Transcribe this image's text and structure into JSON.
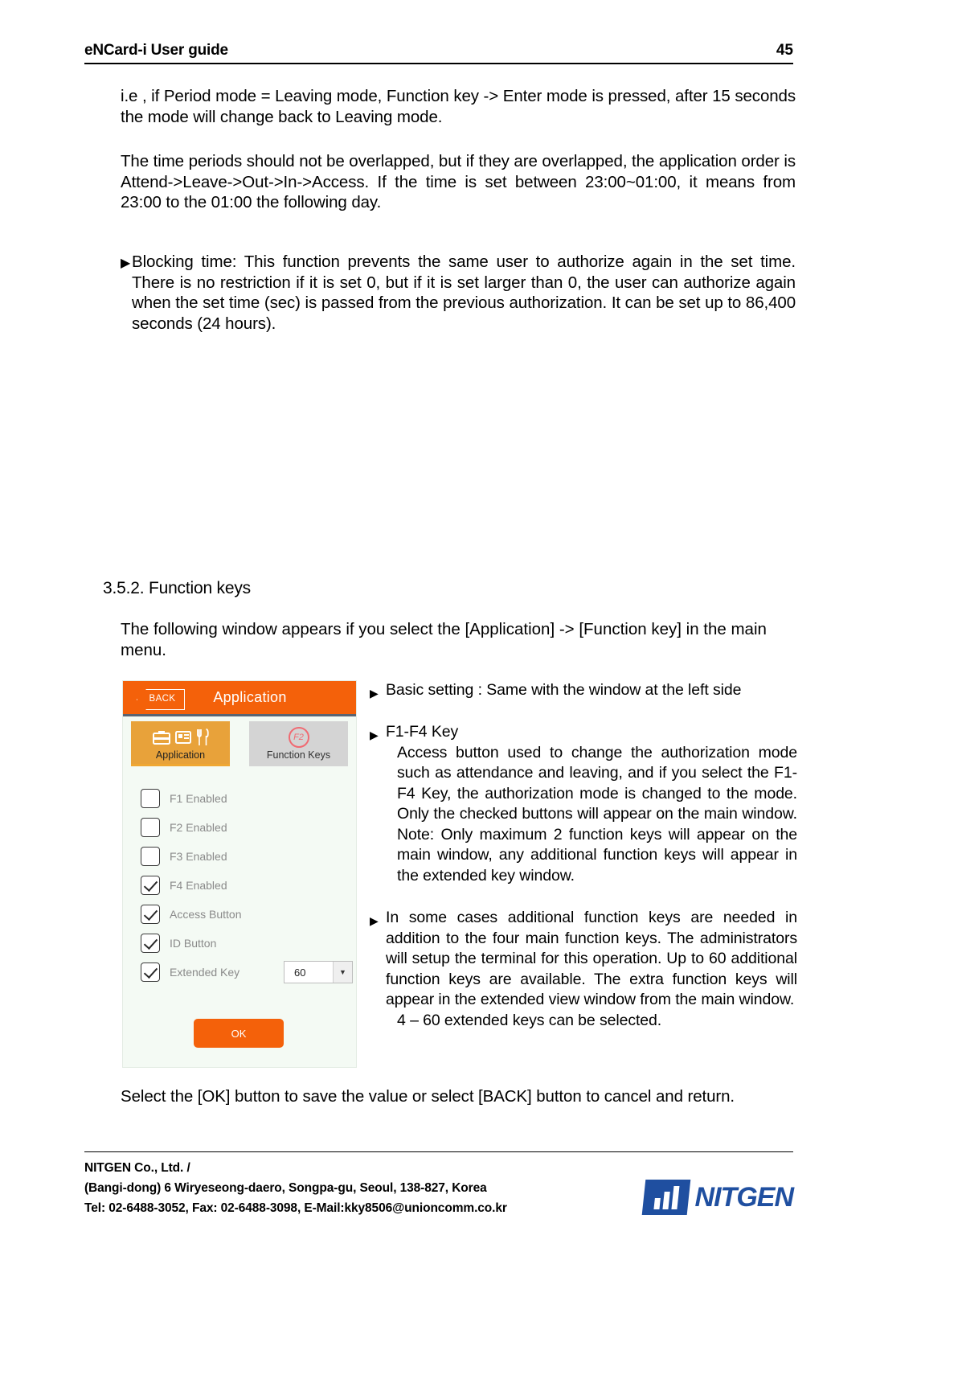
{
  "header": {
    "title": "eNCard-i User guide",
    "page_number": "45"
  },
  "paragraphs": {
    "p1": "i.e , if Period mode = Leaving mode,  Function key -> Enter mode is pressed, after 15 seconds the mode will change back to Leaving mode.",
    "p2": "The time periods should not be overlapped, but if they are overlapped, the application order is Attend->Leave->Out->In->Access. If the time is set between 23:00~01:00, it means from 23:00 to the 01:00 the following day.",
    "blocking_bullet": "Blocking time: This function prevents the same user to authorize again in the set time. There is no restriction if it is set 0, but if it is set larger than 0, the user can authorize again when the set time (sec) is passed from the previous authorization.  It can be set up to 86,400 seconds (24 hours)."
  },
  "section": {
    "heading": "3.5.2. Function keys",
    "intro": "The following window appears if you select the [Application] -> [Function key] in the main menu."
  },
  "device": {
    "back_label": "BACK",
    "screen_title": "Application",
    "tabs": [
      {
        "label": "Application",
        "icons": [
          "briefcase-icon",
          "id-card-icon",
          "cutlery-icon"
        ],
        "active": true
      },
      {
        "label": "Function Keys",
        "icons": [
          "f2-key-icon"
        ],
        "active": false
      }
    ],
    "f2_badge": "F2",
    "checkboxes": [
      {
        "label": "F1 Enabled",
        "checked": false
      },
      {
        "label": "F2 Enabled",
        "checked": false
      },
      {
        "label": "F3 Enabled",
        "checked": false
      },
      {
        "label": "F4 Enabled",
        "checked": true
      },
      {
        "label": "Access Button",
        "checked": true
      },
      {
        "label": "ID Button",
        "checked": true
      },
      {
        "label": "Extended Key",
        "checked": true
      }
    ],
    "extended_key_value": "60",
    "ok_label": "OK"
  },
  "notes": {
    "basic_setting": "Basic setting : Same with the window at the left side",
    "f1f4_title": "F1-F4 Key",
    "f1f4_body": "Access button used to change the authorization mode such as attendance and leaving, and if you select the F1-F4 Key, the authorization mode is changed to the mode. Only the checked buttons will appear on the main window. Note: Only maximum 2 function keys will appear on the main window, any additional function keys will appear in the extended key window.",
    "additional_body": "In some cases additional function keys are needed in addition to the four main function keys.    The administrators will setup the terminal for this operation. Up to 60 additional function keys are available. The extra function keys will appear in the extended view window from the main window.",
    "additional_last_line": "4 – 60 extended keys can be selected."
  },
  "closing": "Select the [OK] button to save the value or select [BACK] button to cancel and return.",
  "footer": {
    "line1": "NITGEN Co., Ltd. /",
    "line2": "(Bangi-dong) 6 Wiryeseong-daero, Songpa-gu, Seoul, 138-827, Korea",
    "line3": "Tel: 02-6488-3052, Fax: 02-6488-3098, E-Mail:kky8506@unioncomm.co.kr",
    "logo_text": "NITGEN"
  },
  "colors": {
    "brand_orange": "#f4610a",
    "tab_active": "#e8a23a",
    "logo_blue": "#1f4fa0"
  },
  "icons": {
    "triangle": "▶",
    "chevron_down": "▼"
  }
}
